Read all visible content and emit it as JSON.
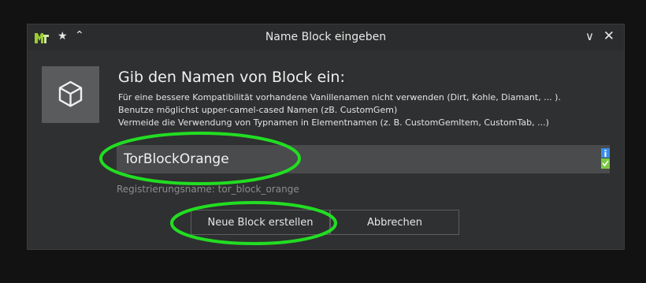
{
  "window": {
    "title": "Name Block eingeben",
    "controls": [
      "pin-icon",
      "keep-above-icon",
      "minimize-chevron-icon",
      "close-icon"
    ]
  },
  "dialog": {
    "icon": "cube-icon",
    "heading": "Gib den Namen von Block ein:",
    "hints": [
      "Für eine bessere Kompatibilität vorhandene Vanillenamen nicht verwenden (Dirt, Kohle, Diamant, ... ).",
      "Benutze möglichst upper-camel-cased Namen (zB. CustomGem)",
      "Vermeide die Verwendung von Typnamen in Elementnamen (z. B. CustomGemItem, CustomTab, ...)"
    ],
    "name_value": "TorBlockOrange",
    "registry_name": "Registrierungsname: tor_block_orange",
    "validation_state": "valid"
  },
  "buttons": {
    "create": "Neue Block erstellen",
    "cancel": "Abbrechen"
  },
  "colors": {
    "highlight": "#22dd22",
    "info": "#3a8ee6",
    "valid": "#7ac943"
  }
}
